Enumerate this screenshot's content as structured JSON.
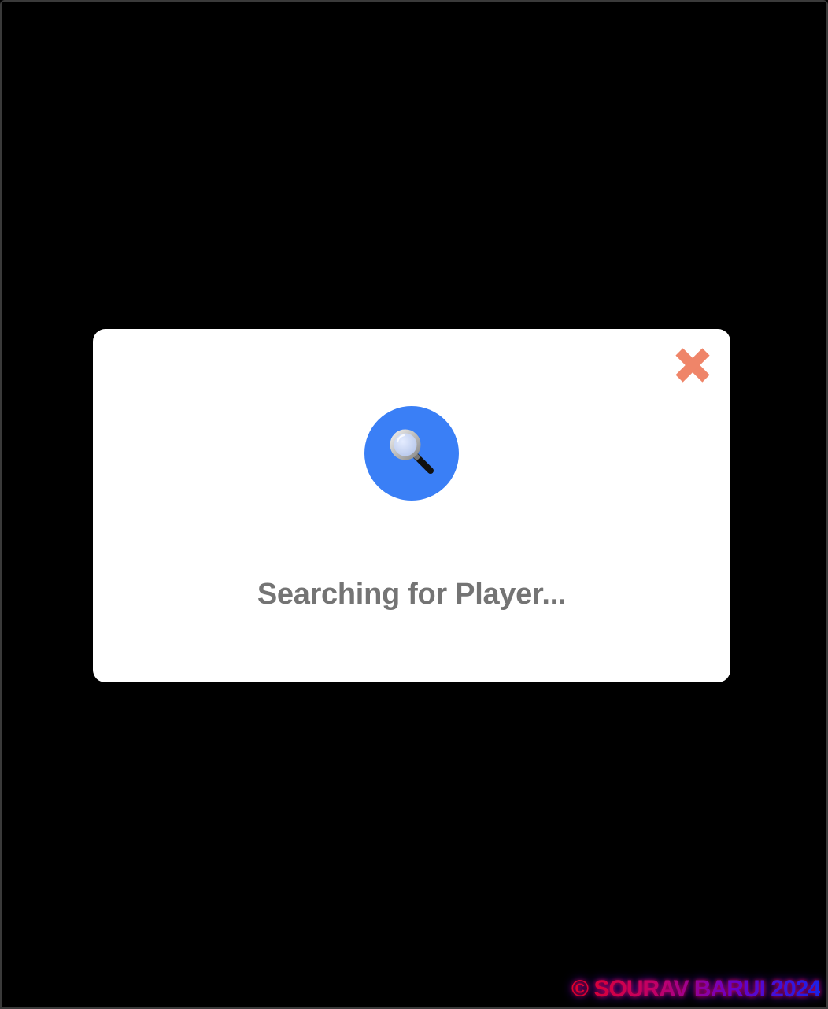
{
  "modal": {
    "status_text": "Searching for Player...",
    "search_icon": "magnifying-glass-icon",
    "close_icon": "close-icon"
  },
  "footer": {
    "watermark": "© SOURAV BARUI 2024"
  },
  "colors": {
    "background": "#000000",
    "modal_background": "#ffffff",
    "accent_blue": "#3a7ff6",
    "close_color": "#ef8569",
    "status_text": "#747474"
  }
}
